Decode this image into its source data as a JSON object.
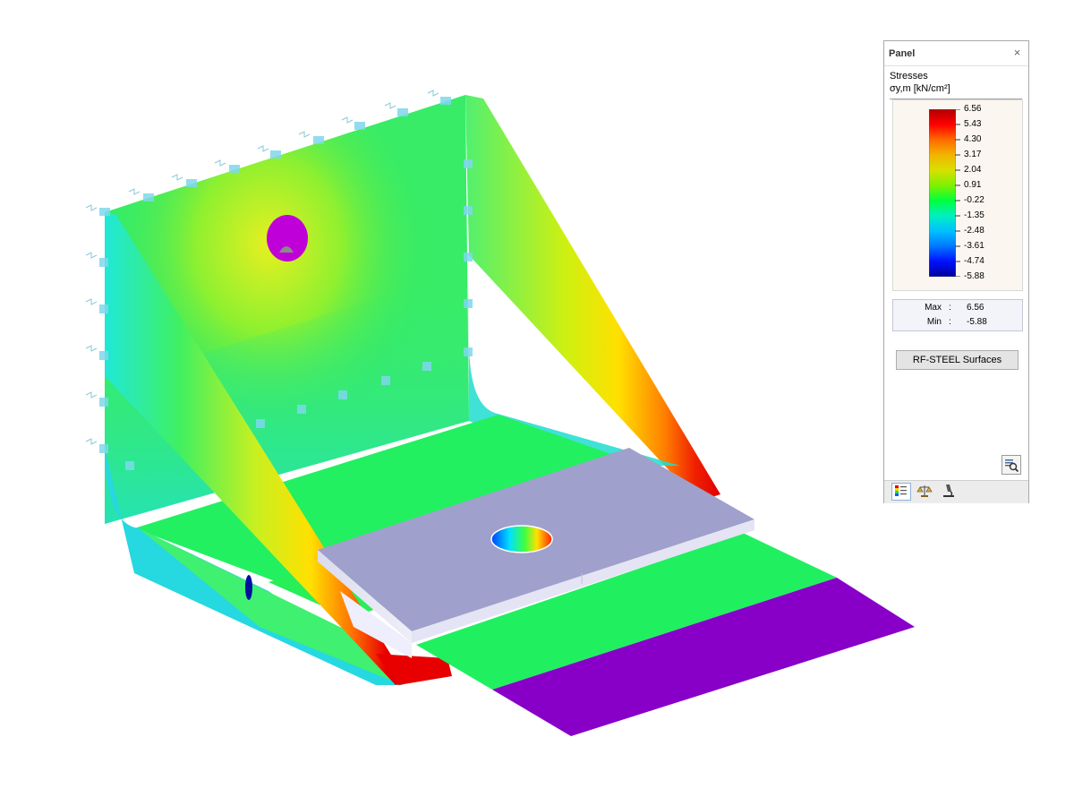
{
  "panel": {
    "title": "Panel",
    "close_glyph": "×",
    "result_name": "Stresses",
    "quantity": "σy,m [kN/cm²]",
    "legend": {
      "values": [
        "6.56",
        "5.43",
        "4.30",
        "3.17",
        "2.04",
        "0.91",
        "-0.22",
        "-1.35",
        "-2.48",
        "-3.61",
        "-4.74",
        "-5.88"
      ],
      "colors": [
        "#b00000",
        "#ff0000",
        "#ff6a00",
        "#f2b400",
        "#d8e000",
        "#7ef000",
        "#00ff3c",
        "#00f0c0",
        "#00c0ff",
        "#0078ff",
        "#0010ff",
        "#000099"
      ]
    },
    "extremes": {
      "max_label": "Max",
      "max_value": "6.56",
      "min_label": "Min",
      "min_value": "-5.88"
    },
    "rf_steel_button": "RF-STEEL Surfaces",
    "icons": {
      "zoom": "zoom-icon",
      "tab_color_scale": "color-scale-icon",
      "tab_balance": "balance-icon",
      "tab_microscope": "microscope-icon"
    }
  }
}
